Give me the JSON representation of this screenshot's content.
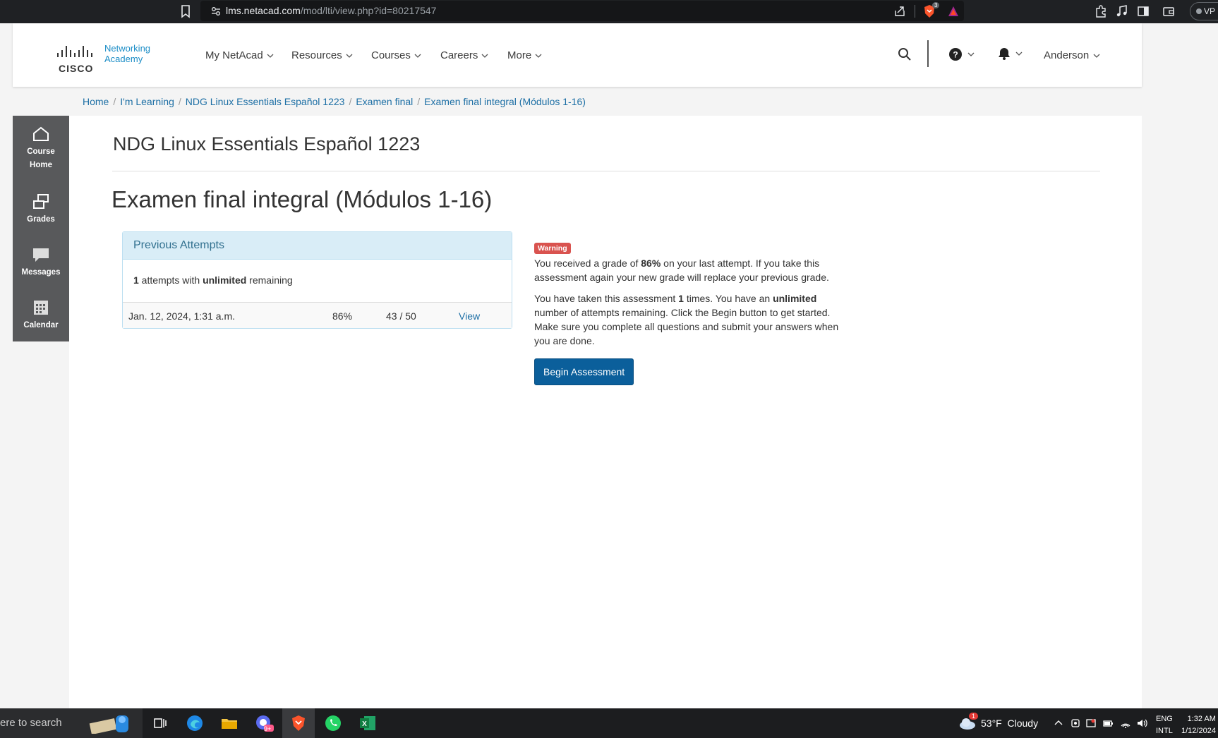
{
  "browser": {
    "url_host": "lms.netacad.com",
    "url_path": "/mod/lti/view.php?id=80217547",
    "shield_count": "3",
    "vpn_label": "VP"
  },
  "header": {
    "logo_line1": "Networking",
    "logo_line2": "Academy",
    "logo_word": "CISCO",
    "nav": [
      "My NetAcad",
      "Resources",
      "Courses",
      "Careers",
      "More"
    ],
    "user": "Anderson"
  },
  "breadcrumb": [
    "Home",
    "I'm Learning",
    "NDG Linux Essentials Español 1223",
    "Examen final",
    "Examen final integral (Módulos 1-16)"
  ],
  "rail": [
    "Course Home",
    "Grades",
    "Messages",
    "Calendar"
  ],
  "main": {
    "course_title": "NDG Linux Essentials Español 1223",
    "page_title": "Examen final integral (Módulos 1-16)"
  },
  "attempts": {
    "heading": "Previous Attempts",
    "count": "1",
    "text1": " attempts with ",
    "unlimited": "unlimited",
    "text2": " remaining",
    "row": {
      "date": "Jan. 12, 2024, 1:31 a.m.",
      "percent": "86%",
      "score": "43 / 50",
      "link": "View"
    }
  },
  "warning": {
    "badge": "Warning",
    "p1_a": "You received a grade of ",
    "p1_grade": "86%",
    "p1_b": " on your last attempt. If you take this assessment again your new grade will replace your previous grade.",
    "p2_a": "You have taken this assessment ",
    "p2_count": "1",
    "p2_b": " times. You have an ",
    "p2_unlimited": "unlimited",
    "p2_c": " number of attempts remaining. Click the Begin button to get started. Make sure you complete all questions and submit your answers when you are done.",
    "button": "Begin Assessment"
  },
  "taskbar": {
    "search_text": "ere to search",
    "weather_badge": "1",
    "weather": "53°F  Cloudy",
    "lang1": "ENG",
    "lang2": "INTL",
    "time": "1:32 AM",
    "date": "1/12/2024",
    "chat_badge": "9+"
  }
}
